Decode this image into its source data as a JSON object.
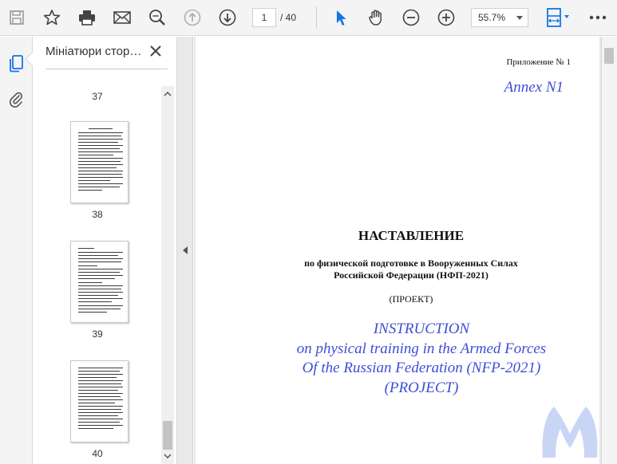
{
  "toolbar": {
    "page_current": "1",
    "page_total": "/  40",
    "zoom": "55.7%",
    "icons": [
      "save-icon",
      "star-icon",
      "print-icon",
      "mail-icon",
      "zoom-search-icon",
      "page-up-icon",
      "page-down-icon",
      "select-cursor-icon",
      "hand-icon",
      "zoom-out-icon",
      "zoom-in-icon",
      "page-fit-icon",
      "more-icon"
    ]
  },
  "rail": {
    "icons": [
      "thumbnails-icon",
      "attachment-icon"
    ]
  },
  "panel": {
    "title": "Мініатюри стор…",
    "thumbnails": [
      {
        "label": "37"
      },
      {
        "label": "38"
      },
      {
        "label": "39"
      },
      {
        "label": "40"
      }
    ]
  },
  "document": {
    "appendix": "Приложение № 1",
    "annex": "Annex N1",
    "title": "НАСТАВЛЕНИЕ",
    "subtitle_line1": "по физической подготовке в Вооруженных Силах",
    "subtitle_line2": "Российской Федерации (НФП-2021)",
    "project": "(ПРОЕКТ)",
    "en_line1": "INSTRUCTION",
    "en_line2": "on physical training in the Armed Forces",
    "en_line3": "Of the Russian Federation (NFP-2021)",
    "en_line4": "(PROJECT)"
  },
  "colors": {
    "accent_blue": "#3d4ed6",
    "icon_blue": "#1473e6",
    "watermark": "#c9d5f5"
  }
}
